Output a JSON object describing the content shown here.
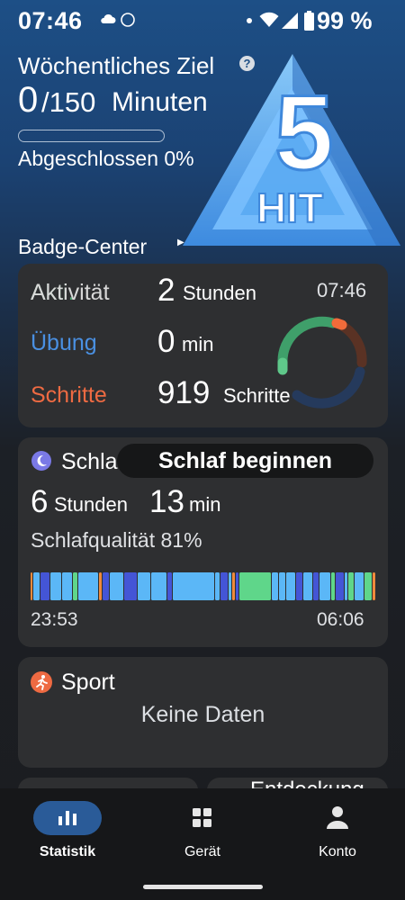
{
  "status_bar": {
    "time": "07:46",
    "battery": "99 %",
    "icons": [
      "cloud-icon",
      "app-notification-icon",
      "dot-icon",
      "wifi-icon",
      "signal-icon",
      "battery-icon"
    ]
  },
  "weekly_goal": {
    "title": "Wöchentliches Ziel",
    "help_icon": "?",
    "current": "0",
    "total": "/150",
    "unit": "Minuten",
    "progress": 0,
    "completed_text": "Abgeschlossen 0%"
  },
  "hiit_logo": {
    "number": "5",
    "text": "HIT"
  },
  "badge_center": {
    "title": "Badge-Center",
    "arrow": "▶"
  },
  "activity": {
    "time": "07:46",
    "overlap_label": "Akti.",
    "rows": [
      {
        "label": "Aktivität",
        "value": "2",
        "unit": "Stunden",
        "color": "#5fc88a"
      },
      {
        "label": "Übung",
        "value": "0",
        "unit": "min",
        "color": "#4a90e2"
      },
      {
        "label": "Schritte",
        "value": "919",
        "unit": "Schritte",
        "color": "#ee6a42"
      }
    ],
    "ring_colors": {
      "green": "#3f9f6a",
      "green_light": "#5fc88a",
      "orange": "#f26b3a",
      "brown": "#5a3224",
      "blue": "#253a5c"
    }
  },
  "sleep": {
    "title": "Schlaf",
    "pill_text": "Schlaf beginnen",
    "hours": "6",
    "hours_unit": "Stunden",
    "minutes": "13",
    "minutes_unit": "min",
    "quality": "Schlafqualität 81%",
    "start": "23:53",
    "end": "06:06",
    "colors": {
      "light": "#5bb7f7",
      "deep": "#4455d6",
      "rem": "#5fd68a",
      "awake": "#f08a3c"
    }
  },
  "sport": {
    "title": "Sport",
    "empty": "Keine Daten"
  },
  "discovery": {
    "title": "Entdeckung"
  },
  "nav": {
    "items": [
      {
        "label": "Statistik",
        "icon": "bar-chart-icon",
        "active": true
      },
      {
        "label": "Gerät",
        "icon": "grid-icon",
        "active": false
      },
      {
        "label": "Konto",
        "icon": "person-icon",
        "active": false
      }
    ]
  }
}
